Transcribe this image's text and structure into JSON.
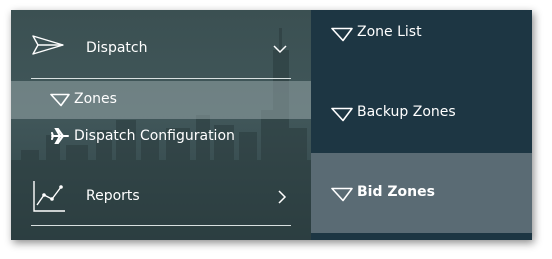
{
  "menu": {
    "dispatch": {
      "label": "Dispatch",
      "icon": "paper-plane-icon",
      "expand_icon": "chevron-down-icon"
    },
    "zones": {
      "label": "Zones",
      "icon": "zone-icon"
    },
    "dispatch_configuration": {
      "label": "Dispatch Configuration",
      "icon": "airplane-icon"
    },
    "reports": {
      "label": "Reports",
      "icon": "line-chart-icon",
      "expand_icon": "chevron-right-icon"
    }
  },
  "submenu": {
    "zone_list": {
      "label": "Zone List",
      "icon": "zone-icon"
    },
    "backup_zones": {
      "label": "Backup Zones",
      "icon": "zone-icon"
    },
    "bid_zones": {
      "label": "Bid Zones",
      "icon": "zone-icon"
    }
  },
  "colors": {
    "submenu_background": "#1d3643",
    "selected_submenu_background": "#5a6b74",
    "selected_menu_highlight": "#7f9092"
  }
}
